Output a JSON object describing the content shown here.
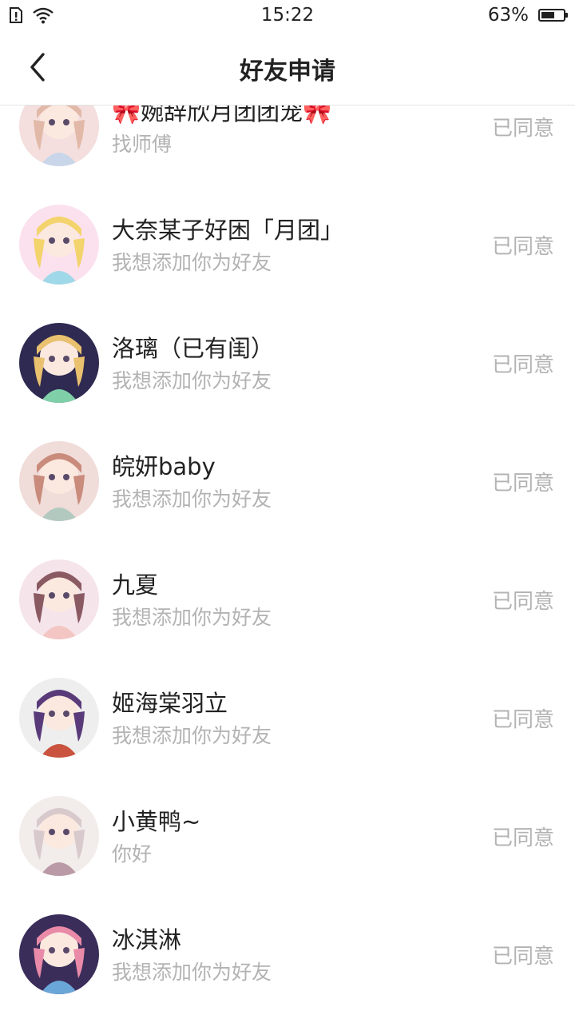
{
  "status_bar": {
    "time": "15:22",
    "battery_percent": "63%",
    "battery_level": 0.63,
    "icons": [
      "sim-alert-icon",
      "wifi-icon",
      "battery-icon"
    ]
  },
  "header": {
    "title": "好友申请",
    "back_icon": "chevron-left-icon"
  },
  "requests": [
    {
      "name": "🎀婉辞欣月团团宠🎀",
      "message": "找师傅",
      "status": "已同意",
      "colors": [
        "#f4dede",
        "#e2b9a8",
        "#c9d6ea"
      ]
    },
    {
      "name": "大奈某子好困「月团」",
      "message": "我想添加你为好友",
      "status": "已同意",
      "colors": [
        "#fbe1ee",
        "#f3d36c",
        "#9fd8e8"
      ]
    },
    {
      "name": "洛璃（已有闺）",
      "message": "我想添加你为好友",
      "status": "已同意",
      "colors": [
        "#2f2a52",
        "#e9c16f",
        "#7fd0a8"
      ]
    },
    {
      "name": "皖妍baby",
      "message": "我想添加你为好友",
      "status": "已同意",
      "colors": [
        "#f0dcd8",
        "#c98b7c",
        "#b2c9c0"
      ]
    },
    {
      "name": "九夏",
      "message": "我想添加你为好友",
      "status": "已同意",
      "colors": [
        "#f5e4ea",
        "#8a5a62",
        "#f3c6c4"
      ]
    },
    {
      "name": "姬海棠羽立",
      "message": "我想添加你为好友",
      "status": "已同意",
      "colors": [
        "#eeeeee",
        "#5a3b7a",
        "#c9533f"
      ]
    },
    {
      "name": "小黄鸭~",
      "message": "你好",
      "status": "已同意",
      "colors": [
        "#f2ecea",
        "#d8c9cc",
        "#b99aa6"
      ]
    },
    {
      "name": "冰淇淋",
      "message": "我想添加你为好友",
      "status": "已同意",
      "colors": [
        "#3a2d5a",
        "#e88aa8",
        "#6aa6d8"
      ]
    }
  ]
}
